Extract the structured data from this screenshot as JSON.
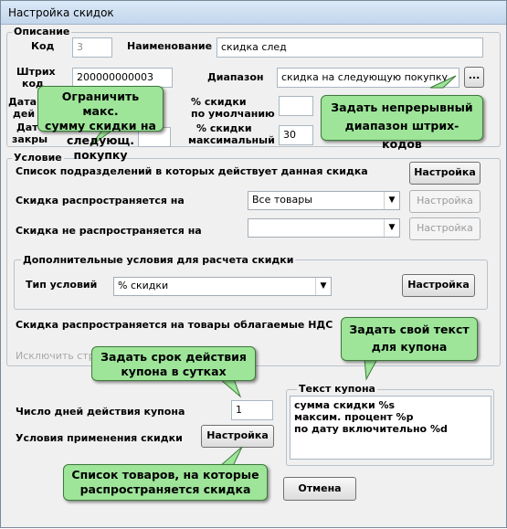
{
  "window": {
    "title": "Настройка скидок"
  },
  "description": {
    "group_label": "Описание",
    "code_label": "Код",
    "code_value": "3",
    "name_label": "Наименование",
    "name_value": "скидка след",
    "barcode_label_1": "Штрих",
    "barcode_label_2": "код",
    "barcode_value": "200000000003",
    "range_label": "Диапазон",
    "range_value": "скидка на следующую покупку",
    "range_button": "...",
    "date_label_1a": "Дата",
    "date_label_1b": "дей",
    "date_label_2a": "Дат",
    "date_label_2b": "закры",
    "pct_default_label_1": "% скидки",
    "pct_default_label_2": "по умолчанию",
    "pct_default_value": "",
    "pct_max_label_1": "% скидки",
    "pct_max_label_2": "максимальный",
    "pct_max_value": "30"
  },
  "condition": {
    "group_label": "Условие",
    "departments_label": "Список подразделений в которых действует данная скидка",
    "departments_button": "Настройка",
    "applies_label": "Скидка распространяется на",
    "applies_value": "Все товары",
    "applies_button": "Настройка",
    "not_applies_label": "Скидка не распространяется на",
    "not_applies_value": "",
    "not_applies_button": "Настройка",
    "extra_group_label": "Дополнительные условия для расчета  скидки",
    "condition_type_label": "Тип условий",
    "condition_type_value": "% скидки",
    "condition_type_button": "Настройка",
    "vat_label": "Скидка распространяется  на товары облагаемые НДС",
    "exclude_label": "Исключить стр"
  },
  "coupon": {
    "days_label": "Число дней действия купона",
    "days_value": "1",
    "usage_label": "Условия применения скидки",
    "usage_button": "Настройка",
    "text_group_label": "Текст купона",
    "text_line_1": "сумма скидки %s",
    "text_line_2": "максим. процент %p",
    "text_line_3": "по дату включительно %d"
  },
  "footer": {
    "cancel_button": "Отмена"
  },
  "callouts": {
    "limit_1": "Ограничить макс.",
    "limit_2": "сумму скидки на",
    "limit_3": "следующ. покупку",
    "range_1": "Задать непрерывный",
    "range_2": "диапазон штрих-кодов",
    "text_1": "Задать свой текст",
    "text_2": "для купона",
    "days_1": "Задать срок действия",
    "days_2": "купона в сутках",
    "list_1": "Список товаров, на которые",
    "list_2": "распространяется скидка"
  },
  "colors": {
    "callout_fill": "#9ee59a",
    "callout_border": "#3c7a3a"
  }
}
